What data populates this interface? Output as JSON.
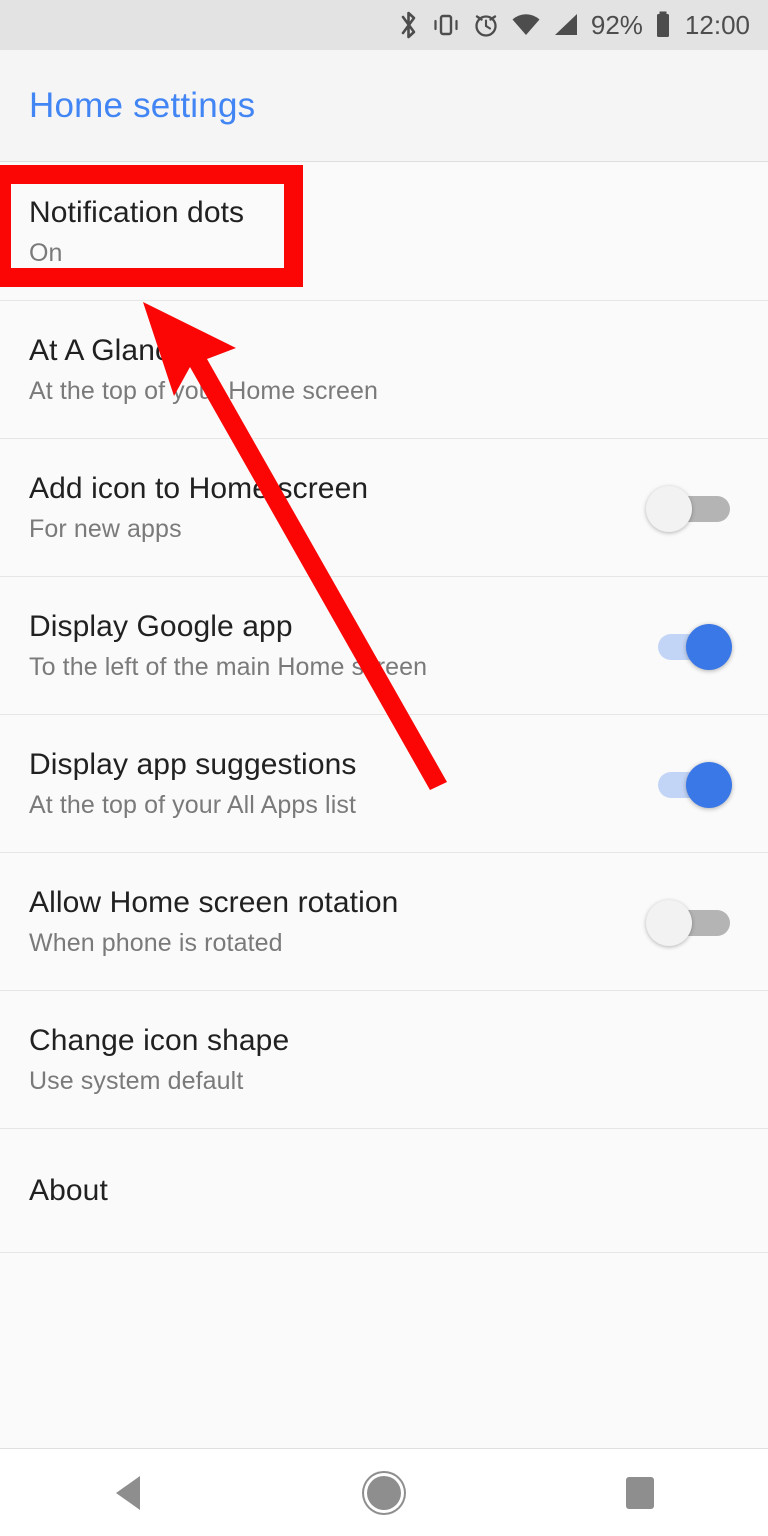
{
  "status_bar": {
    "icons": [
      "bluetooth-icon",
      "vibrate-icon",
      "alarm-icon",
      "wifi-icon",
      "signal-icon"
    ],
    "battery_percent": "92%",
    "battery_icon": "battery-icon",
    "clock": "12:00"
  },
  "header": {
    "title": "Home settings",
    "title_color": "#4285f4"
  },
  "settings": {
    "rows": [
      {
        "title": "Notification dots",
        "subtitle": "On",
        "control": "none",
        "name": "notification-dots"
      },
      {
        "title": "At A Glance",
        "subtitle": "At the top of your Home screen",
        "control": "none",
        "name": "at-a-glance"
      },
      {
        "title": "Add icon to Home screen",
        "subtitle": "For new apps",
        "control": "toggle",
        "state": "off",
        "name": "add-icon-to-home-screen"
      },
      {
        "title": "Display Google app",
        "subtitle": "To the left of the main Home screen",
        "control": "toggle",
        "state": "on",
        "name": "display-google-app"
      },
      {
        "title": "Display app suggestions",
        "subtitle": "At the top of your All Apps list",
        "control": "toggle",
        "state": "on",
        "name": "display-app-suggestions"
      },
      {
        "title": "Allow Home screen rotation",
        "subtitle": "When phone is rotated",
        "control": "toggle",
        "state": "off",
        "name": "allow-home-screen-rotation"
      },
      {
        "title": "Change icon shape",
        "subtitle": "Use system default",
        "control": "none",
        "name": "change-icon-shape"
      },
      {
        "title": "About",
        "subtitle": "",
        "control": "none",
        "name": "about"
      }
    ]
  },
  "annotations": {
    "highlight_color": "#fb0505",
    "arrow_color": "#fb0505",
    "highlight_target": "Notification dots",
    "arrow_points_to": "Notification dots"
  },
  "nav_bar": {
    "back_label": "back-button",
    "home_label": "home-button",
    "recents_label": "recents-button"
  }
}
